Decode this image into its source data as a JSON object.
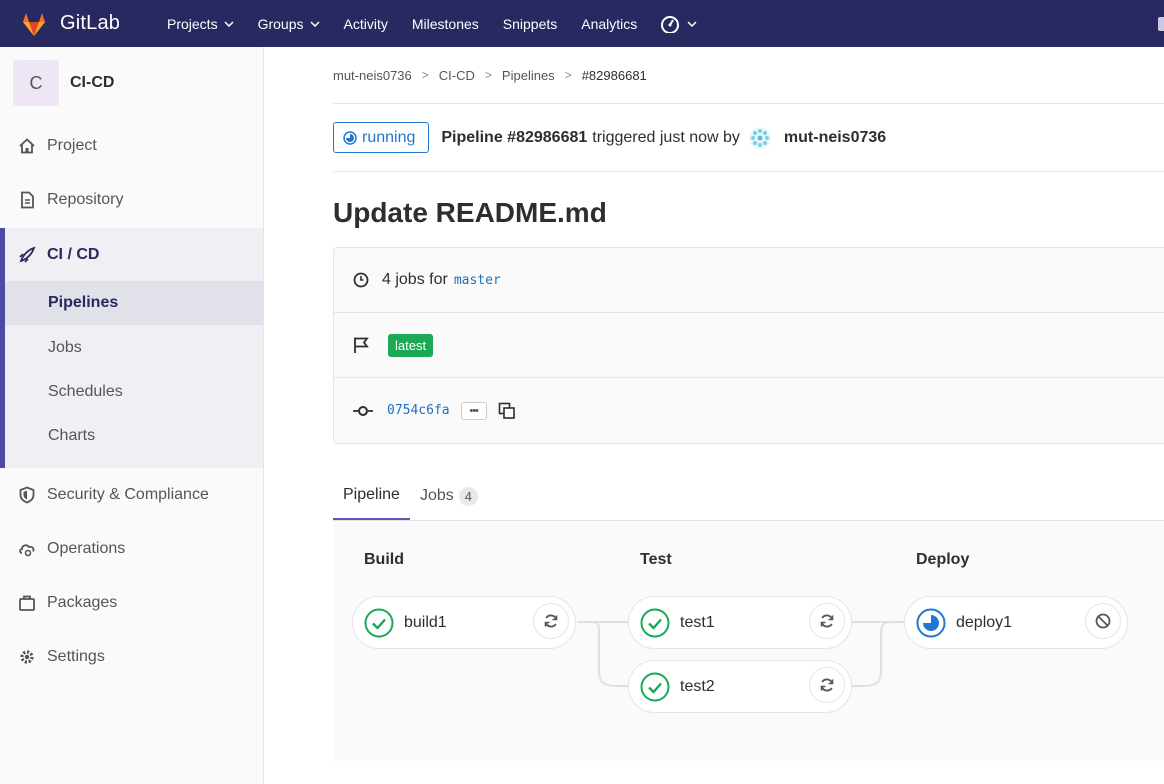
{
  "nav": {
    "brand": "GitLab",
    "items": [
      {
        "label": "Projects",
        "dropdown": true
      },
      {
        "label": "Groups",
        "dropdown": true
      },
      {
        "label": "Activity",
        "dropdown": false
      },
      {
        "label": "Milestones",
        "dropdown": false
      },
      {
        "label": "Snippets",
        "dropdown": false
      },
      {
        "label": "Analytics",
        "dropdown": false
      }
    ],
    "performance_icon": "dashboard-icon"
  },
  "sidebar": {
    "project_initial": "C",
    "project_name": "CI-CD",
    "items": {
      "project": "Project",
      "repository": "Repository",
      "cicd": "CI / CD",
      "security": "Security & Compliance",
      "operations": "Operations",
      "packages": "Packages",
      "settings": "Settings"
    },
    "cicd_sub": {
      "pipelines": "Pipelines",
      "jobs": "Jobs",
      "schedules": "Schedules",
      "charts": "Charts"
    }
  },
  "breadcrumb": {
    "items": [
      "mut-neis0736",
      "CI-CD",
      "Pipelines"
    ],
    "current": "#82986681",
    "separator": ">"
  },
  "pipeline": {
    "status": "running",
    "title": "Pipeline #82986681",
    "triggered_text": "triggered just now by",
    "user": "mut-neis0736",
    "commit_title": "Update README.md"
  },
  "info": {
    "jobs_prefix": "4 jobs for",
    "branch": "master",
    "tag": "latest",
    "sha": "0754c6fa",
    "ellipsis": "•••"
  },
  "tabs": {
    "pipeline": "Pipeline",
    "jobs": "Jobs",
    "jobs_count": "4"
  },
  "stages": [
    {
      "name": "Build",
      "jobs": [
        {
          "name": "build1",
          "status": "success",
          "action": "retry"
        }
      ]
    },
    {
      "name": "Test",
      "jobs": [
        {
          "name": "test1",
          "status": "success",
          "action": "retry"
        },
        {
          "name": "test2",
          "status": "success",
          "action": "retry"
        }
      ]
    },
    {
      "name": "Deploy",
      "jobs": [
        {
          "name": "deploy1",
          "status": "running",
          "action": "cancel"
        }
      ]
    }
  ],
  "colors": {
    "nav_bg": "#292961",
    "accent": "#6b4fbb",
    "running": "#1f78d1",
    "success": "#1aaa55"
  }
}
